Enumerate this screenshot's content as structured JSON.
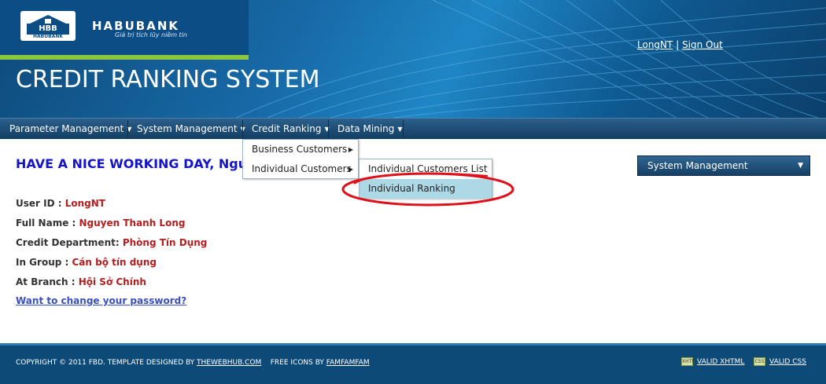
{
  "header": {
    "brand_name": "HABUBANK",
    "brand_slogan": "Giá trị tích lũy niềm tin",
    "logo_mark": "HBB",
    "logo_sub": "HABUBANK",
    "system_title": "CREDIT RANKING SYSTEM",
    "user_link": "LongNT",
    "separator": "|",
    "signout_link": "Sign Out"
  },
  "nav": {
    "items": [
      {
        "label": "Parameter Management"
      },
      {
        "label": "System Management"
      },
      {
        "label": "Credit Ranking"
      },
      {
        "label": "Data Mining"
      }
    ]
  },
  "credit_menu": {
    "items": [
      {
        "label": "Business Customers"
      },
      {
        "label": "Individual Customers"
      }
    ]
  },
  "individual_submenu": {
    "items": [
      {
        "label": "Individual Customers List"
      },
      {
        "label": "Individual Ranking"
      }
    ]
  },
  "main": {
    "welcome": "HAVE A NICE WORKING DAY, Nguyen Thanh Long",
    "info": [
      {
        "label": "User ID : ",
        "value": "LongNT"
      },
      {
        "label": "Full Name : ",
        "value": "Nguyen Thanh Long"
      },
      {
        "label": "Credit Department: ",
        "value": "Phòng Tín Dụng"
      },
      {
        "label": "In Group : ",
        "value": "Cán bộ tín dụng"
      },
      {
        "label": "At Branch : ",
        "value": "Hội Sở Chính"
      }
    ],
    "password_link": "Want to change your password?"
  },
  "side_select": {
    "value": "System Management"
  },
  "footer": {
    "copyright": "COPYRIGHT © 2011 FBD. TEMPLATE DESIGNED BY ",
    "template_link": "THEWEBHUB.COM",
    "icons_text": "FREE ICONS BY ",
    "icons_link": "FAMFAMFAM",
    "valid_xhtml": "VALID XHTML",
    "valid_css": "VALID CSS",
    "xhtml_badge": "XHTML",
    "css_badge": "CSS"
  },
  "colors": {
    "header_blue": "#0c4d85",
    "accent_green": "#8cc63f",
    "welcome_blue": "#1414c8",
    "value_red": "#b41e1e",
    "highlight": "#add8e6",
    "annotation_red": "#e0101a"
  }
}
